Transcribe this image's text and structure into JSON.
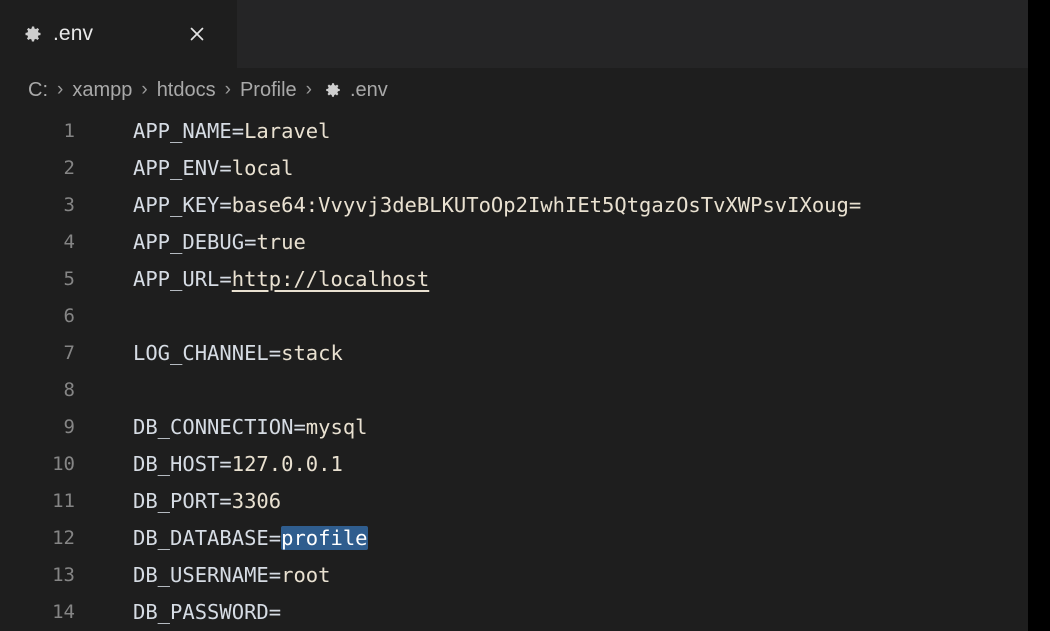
{
  "window": {
    "theme": "vscode-dark",
    "background": "#1e1e1e",
    "tabbar_background": "#252526",
    "right_band_color": "#000000"
  },
  "tab": {
    "label": ".env",
    "icon": "gear-icon",
    "close_icon": "close-icon",
    "active": true
  },
  "breadcrumb": {
    "separator": "›",
    "segments": [
      {
        "label": "C:"
      },
      {
        "label": "xampp"
      },
      {
        "label": "htdocs"
      },
      {
        "label": "Profile"
      }
    ],
    "file": {
      "label": ".env",
      "icon": "gear-icon"
    }
  },
  "editor": {
    "language": "dotenv",
    "selection_color": "#2f5d8e",
    "link_color": "#e9e1d1",
    "linenumber_color": "#858585",
    "lines": [
      {
        "n": "1",
        "key": "APP_NAME",
        "eq": "=",
        "value": "Laravel"
      },
      {
        "n": "2",
        "key": "APP_ENV",
        "eq": "=",
        "value": "local"
      },
      {
        "n": "3",
        "key": "APP_KEY",
        "eq": "=",
        "value": "base64:Vvyvj3deBLKUToOp2IwhIEt5QtgazOsTvXWPsvIXoug="
      },
      {
        "n": "4",
        "key": "APP_DEBUG",
        "eq": "=",
        "value": "true"
      },
      {
        "n": "5",
        "key": "APP_URL",
        "eq": "=",
        "value": "http://localhost",
        "link": true
      },
      {
        "n": "6",
        "key": "",
        "eq": "",
        "value": ""
      },
      {
        "n": "7",
        "key": "LOG_CHANNEL",
        "eq": "=",
        "value": "stack"
      },
      {
        "n": "8",
        "key": "",
        "eq": "",
        "value": ""
      },
      {
        "n": "9",
        "key": "DB_CONNECTION",
        "eq": "=",
        "value": "mysql"
      },
      {
        "n": "10",
        "key": "DB_HOST",
        "eq": "=",
        "value": "127.0.0.1"
      },
      {
        "n": "11",
        "key": "DB_PORT",
        "eq": "=",
        "value": "3306"
      },
      {
        "n": "12",
        "key": "DB_DATABASE",
        "eq": "=",
        "value": "profile",
        "selected": true
      },
      {
        "n": "13",
        "key": "DB_USERNAME",
        "eq": "=",
        "value": "root"
      },
      {
        "n": "14",
        "key": "DB_PASSWORD",
        "eq": "=",
        "value": ""
      }
    ]
  }
}
